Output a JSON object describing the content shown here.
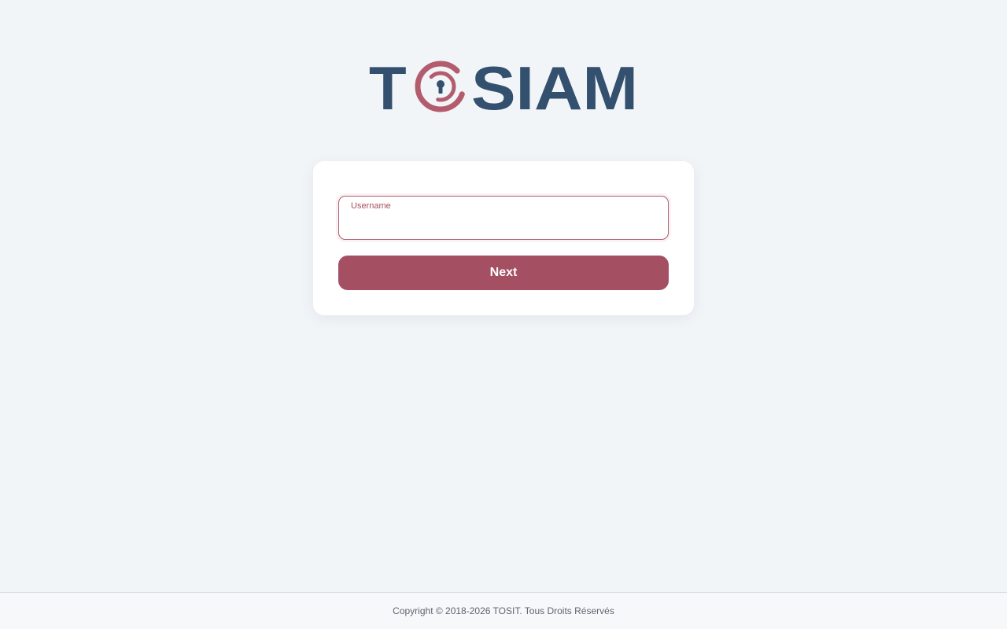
{
  "brand": {
    "logo_text_left": "T",
    "logo_text_right": "SIAM",
    "icon": "keyhole-target-icon",
    "text_color": "#34506f",
    "accent_color": "#b35c6e"
  },
  "login": {
    "username_label": "Username",
    "username_value": "",
    "next_label": "Next",
    "button_color": "#a44f62"
  },
  "footer": {
    "copyright": "Copyright © 2018-2026 TOSIT. Tous Droits Réservés"
  }
}
